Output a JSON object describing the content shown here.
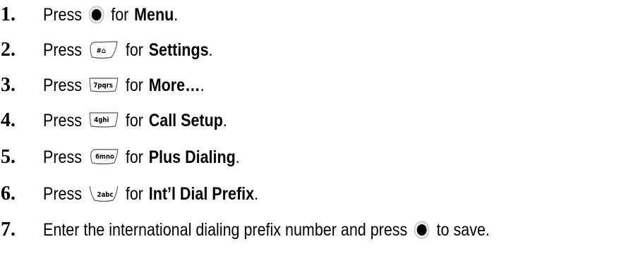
{
  "steps": [
    {
      "number": "1.",
      "pre": "Press",
      "key": {
        "icon": "ok-button-icon",
        "label": ""
      },
      "mid": "for",
      "bold": "Menu",
      "post": "."
    },
    {
      "number": "2.",
      "pre": "Press",
      "key": {
        "icon": "pound-key-icon",
        "label": "#⌂"
      },
      "mid": "for",
      "bold": "Settings",
      "post": "."
    },
    {
      "number": "3.",
      "pre": "Press",
      "key": {
        "icon": "seven-key-icon",
        "label": "7pqrs"
      },
      "mid": "for",
      "bold": "More…",
      "post": "."
    },
    {
      "number": "4.",
      "pre": "Press",
      "key": {
        "icon": "four-key-icon",
        "label": "4ghi"
      },
      "mid": "for",
      "bold": "Call Setup",
      "post": "."
    },
    {
      "number": "5.",
      "pre": "Press",
      "key": {
        "icon": "six-key-icon",
        "label": "6mno"
      },
      "mid": "for",
      "bold": "Plus Dialing",
      "post": "."
    },
    {
      "number": "6.",
      "pre": "Press",
      "key": {
        "icon": "two-key-icon",
        "label": "2abc"
      },
      "mid": "for",
      "bold": "Int’l Dial Prefix",
      "post": "."
    },
    {
      "number": "7.",
      "pre": "Enter the international dialing prefix number and press",
      "key": {
        "icon": "ok-button-icon",
        "label": ""
      },
      "mid": "to save.",
      "bold": "",
      "post": ""
    }
  ]
}
